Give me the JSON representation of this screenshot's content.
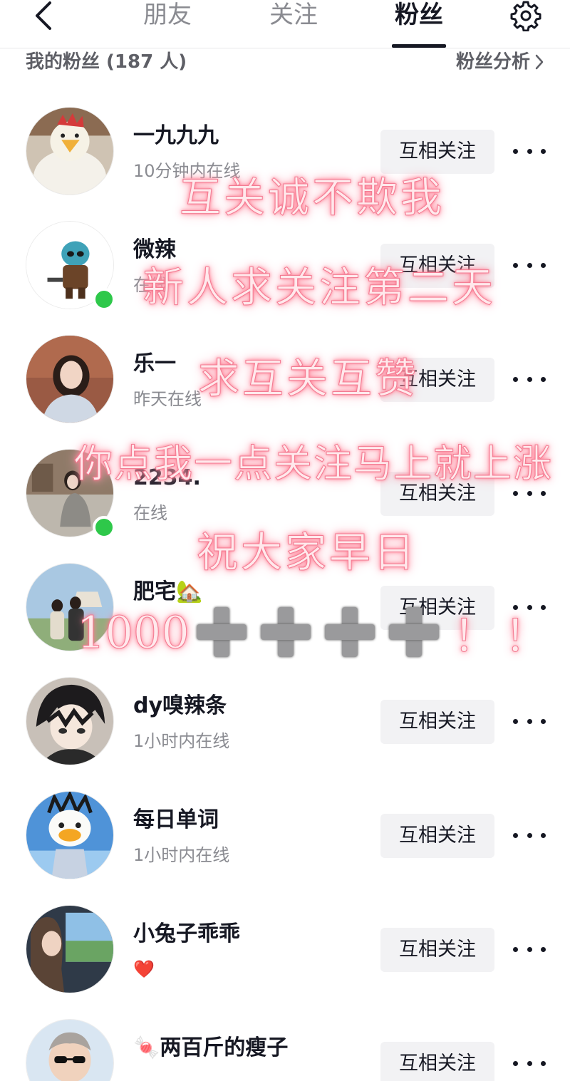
{
  "header": {
    "tabs": [
      {
        "label": "朋友",
        "active": false
      },
      {
        "label": "关注",
        "active": false
      },
      {
        "label": "粉丝",
        "active": true
      }
    ]
  },
  "subheader": {
    "count_label": "我的粉丝 (187 人)",
    "analysis_label": "粉丝分析"
  },
  "follow_label": "互相关注",
  "fans": [
    {
      "name": "一九九九",
      "status": "10分钟内在线",
      "online": false,
      "avatar": "chicken-mascot-avatar"
    },
    {
      "name": "微辣",
      "status": "在线",
      "online": true,
      "avatar": "masked-character-avatar"
    },
    {
      "name": "乐一",
      "status": "昨天在线",
      "online": false,
      "avatar": "girl-portrait-avatar"
    },
    {
      "name": "2234.",
      "status": "在线",
      "online": true,
      "avatar": "girl-sitting-avatar"
    },
    {
      "name": "肥宅🏡",
      "status": "",
      "online": false,
      "avatar": "couple-outdoor-avatar"
    },
    {
      "name": "dy嗅辣条",
      "status": "1小时内在线",
      "online": false,
      "avatar": "anime-boy-avatar"
    },
    {
      "name": "每日单词",
      "status": "1小时内在线",
      "online": false,
      "avatar": "duck-doll-avatar"
    },
    {
      "name": "小兔子乖乖",
      "status": "❤️",
      "online": false,
      "avatar": "girl-car-avatar"
    },
    {
      "name": "🍬两百斤的瘦子",
      "status": "",
      "online": false,
      "avatar": "boy-sunglasses-avatar"
    }
  ],
  "overlay": {
    "line1": "互关诚不欺我",
    "line2": "新人求关注第二天",
    "line3": "求互关互赞",
    "line4": "你点我一点关注马上就上涨",
    "line5": "祝大家早日",
    "line6_number": "1000",
    "line6_suffix": "！！"
  },
  "colors": {
    "online_dot": "#2ec84a",
    "follow_button_bg": "#f2f2f4",
    "overlay_glow": "#ff8fa3"
  },
  "icons": {
    "back": "chevron-left-icon",
    "settings": "gear-icon",
    "more": "more-horizontal-icon",
    "analysis": "chevron-right-icon"
  }
}
